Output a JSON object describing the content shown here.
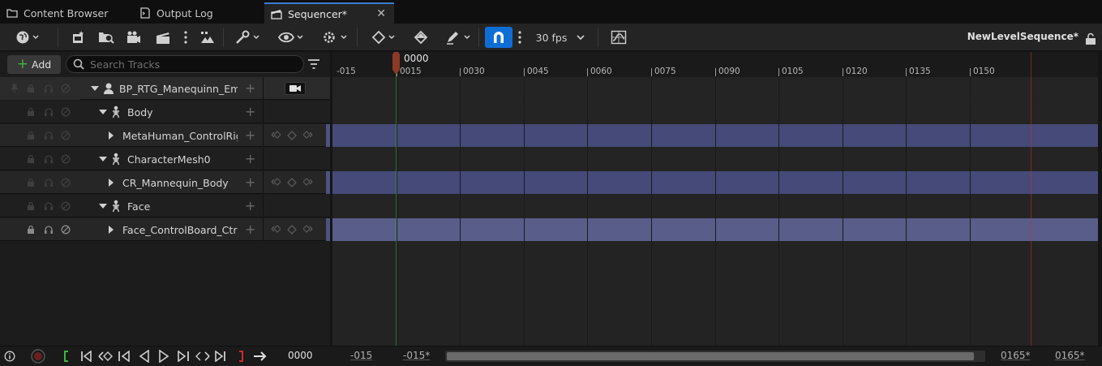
{
  "tabs": [
    {
      "label": "Content Browser",
      "icon": "folder-icon",
      "active": false
    },
    {
      "label": "Output Log",
      "icon": "log-icon",
      "active": false
    },
    {
      "label": "Sequencer*",
      "icon": "clapper-icon",
      "active": true
    }
  ],
  "tab_close": "✕",
  "toolbar": {
    "fps_label": "30 fps",
    "sequence_name": "NewLevelSequence*",
    "snap_active": true,
    "accent_color": "#0f6ed6"
  },
  "left_panel": {
    "add_label": "Add",
    "search_placeholder": "Search Tracks",
    "tracks": [
      {
        "name": "BP_RTG_Manequinn_Emory",
        "level": 0,
        "expanded": true,
        "has_camera": true,
        "icon": "actor-icon"
      },
      {
        "name": "Body",
        "level": 1,
        "expanded": true,
        "icon": "skeleton-icon"
      },
      {
        "name": "MetaHuman_ControlRig",
        "level": 2,
        "expanded": false,
        "icon": "none",
        "keyed": true
      },
      {
        "name": "CharacterMesh0",
        "level": 1,
        "expanded": true,
        "icon": "skeleton-icon"
      },
      {
        "name": "CR_Mannequin_Body",
        "level": 2,
        "expanded": false,
        "icon": "none",
        "keyed": true
      },
      {
        "name": "Face",
        "level": 1,
        "expanded": true,
        "icon": "skeleton-icon"
      },
      {
        "name": "Face_ControlBoard_CtrlRig",
        "level": 2,
        "expanded": false,
        "icon": "none",
        "keyed": true
      }
    ]
  },
  "timeline": {
    "playhead_frame": "0000",
    "ticks": [
      "-015",
      "0015",
      "0030",
      "0045",
      "0060",
      "0075",
      "0090",
      "0105",
      "0120",
      "0135",
      "0150"
    ],
    "section_color": "#454a78",
    "start_color": "#3fb63f",
    "end_color": "#d12a2a"
  },
  "bottom_bar": {
    "current_frame": "0000",
    "view_start": "-015",
    "working_start": "-015*",
    "working_end": "0165*",
    "view_end": "0165*"
  }
}
